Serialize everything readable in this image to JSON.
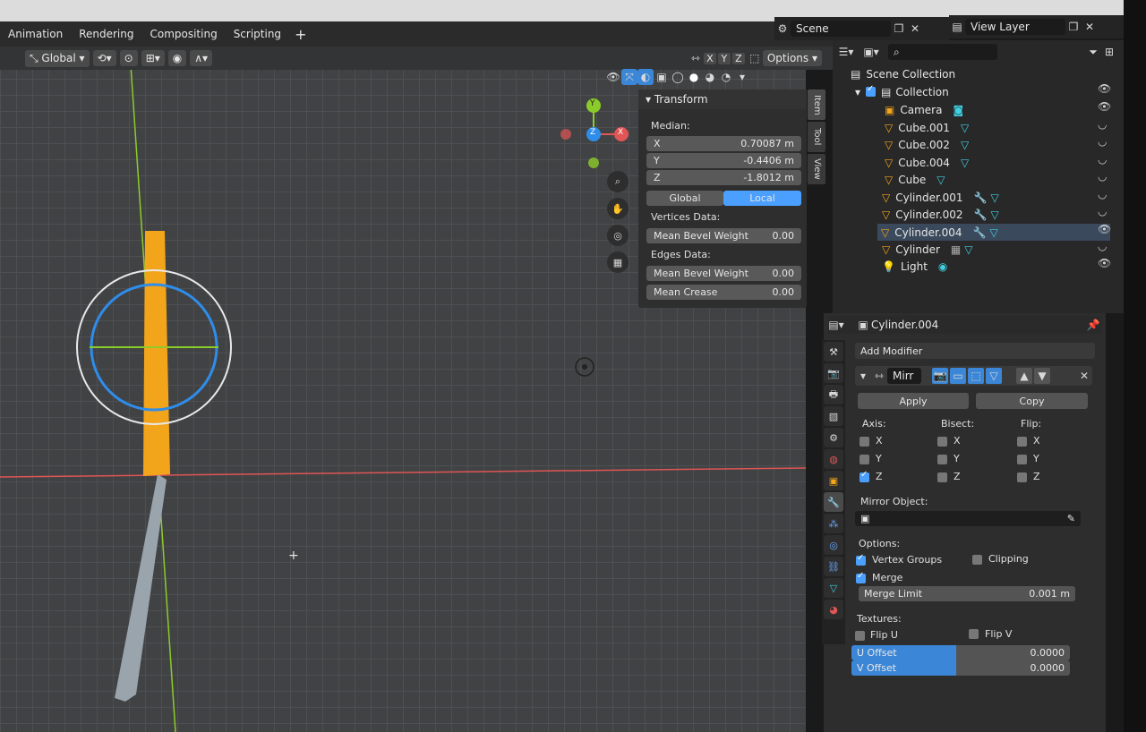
{
  "workspace_tabs": [
    "Animation",
    "Rendering",
    "Compositing",
    "Scripting"
  ],
  "scene": {
    "label": "Scene"
  },
  "view_layer": {
    "label": "View Layer"
  },
  "viewport": {
    "orientation": "Global",
    "options_label": "Options",
    "axes": [
      "X",
      "Y",
      "Z"
    ],
    "gizmo": {
      "y": "Y",
      "z": "Z",
      "x": "X"
    }
  },
  "npanel": {
    "title": "Transform",
    "median_label": "Median:",
    "fields": [
      {
        "label": "X",
        "value": "0.70087 m"
      },
      {
        "label": "Y",
        "value": "-0.4406 m"
      },
      {
        "label": "Z",
        "value": "-1.8012 m"
      }
    ],
    "space_global": "Global",
    "space_local": "Local",
    "vertices_label": "Vertices Data:",
    "vertex_bevel": {
      "label": "Mean Bevel Weight",
      "value": "0.00"
    },
    "edges_label": "Edges Data:",
    "edge_bevel": {
      "label": "Mean Bevel Weight",
      "value": "0.00"
    },
    "edge_crease": {
      "label": "Mean Crease",
      "value": "0.00"
    },
    "side_tabs": [
      "Item",
      "Tool",
      "View"
    ]
  },
  "outliner": {
    "scene_collection": "Scene Collection",
    "collection": "Collection",
    "items": [
      {
        "name": "Camera"
      },
      {
        "name": "Cube.001"
      },
      {
        "name": "Cube.002"
      },
      {
        "name": "Cube.004"
      },
      {
        "name": "Cube"
      },
      {
        "name": "Cylinder.001"
      },
      {
        "name": "Cylinder.002"
      },
      {
        "name": "Cylinder.004"
      },
      {
        "name": "Cylinder"
      },
      {
        "name": "Light"
      }
    ]
  },
  "properties": {
    "object_name": "Cylinder.004",
    "add_modifier": "Add Modifier",
    "modifier_name": "Mirr",
    "apply": "Apply",
    "copy": "Copy",
    "axis_label": "Axis:",
    "bisect_label": "Bisect:",
    "flip_label": "Flip:",
    "x": "X",
    "y": "Y",
    "z": "Z",
    "mirror_object_label": "Mirror Object:",
    "options_label": "Options:",
    "vertex_groups": "Vertex Groups",
    "clipping": "Clipping",
    "merge": "Merge",
    "merge_limit": {
      "label": "Merge Limit",
      "value": "0.001 m"
    },
    "textures_label": "Textures:",
    "flip_u": "Flip U",
    "flip_v": "Flip V",
    "u_offset": {
      "label": "U Offset",
      "value": "0.0000"
    },
    "v_offset": {
      "label": "V Offset",
      "value": "0.0000"
    }
  },
  "colors": {
    "accent": "#4a9fff",
    "selection_orange": "#f2a41b",
    "x_axis": "#e05555",
    "y_axis": "#8ccc2a",
    "z_axis": "#2f8dea"
  }
}
